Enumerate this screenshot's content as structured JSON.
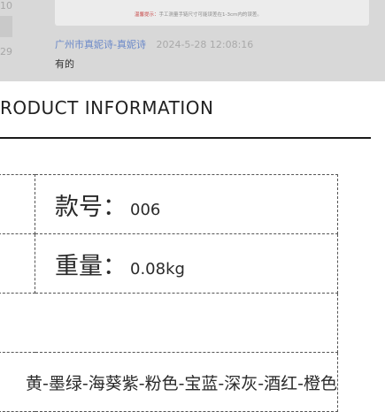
{
  "review": {
    "left_date_1": "-10",
    "left_date_2": "-29",
    "card_warning_label": "温馨提示：",
    "card_note": "手工测量手链尺寸可能误差在1-3cm内的误差。",
    "reviewer_name": "广州市真妮诗-真妮诗",
    "reviewer_time": "2024-5-28 12:08:16",
    "comment": "有的"
  },
  "section": {
    "title": "RODUCT INFORMATION"
  },
  "product": {
    "model_label": "款号：",
    "model_value": "006",
    "weight_label": "重量：",
    "weight_value": "0.08kg",
    "empty_row": "",
    "colors": "黄-墨绿-海葵紫-粉色-宝蓝-深灰-酒红-橙色"
  }
}
